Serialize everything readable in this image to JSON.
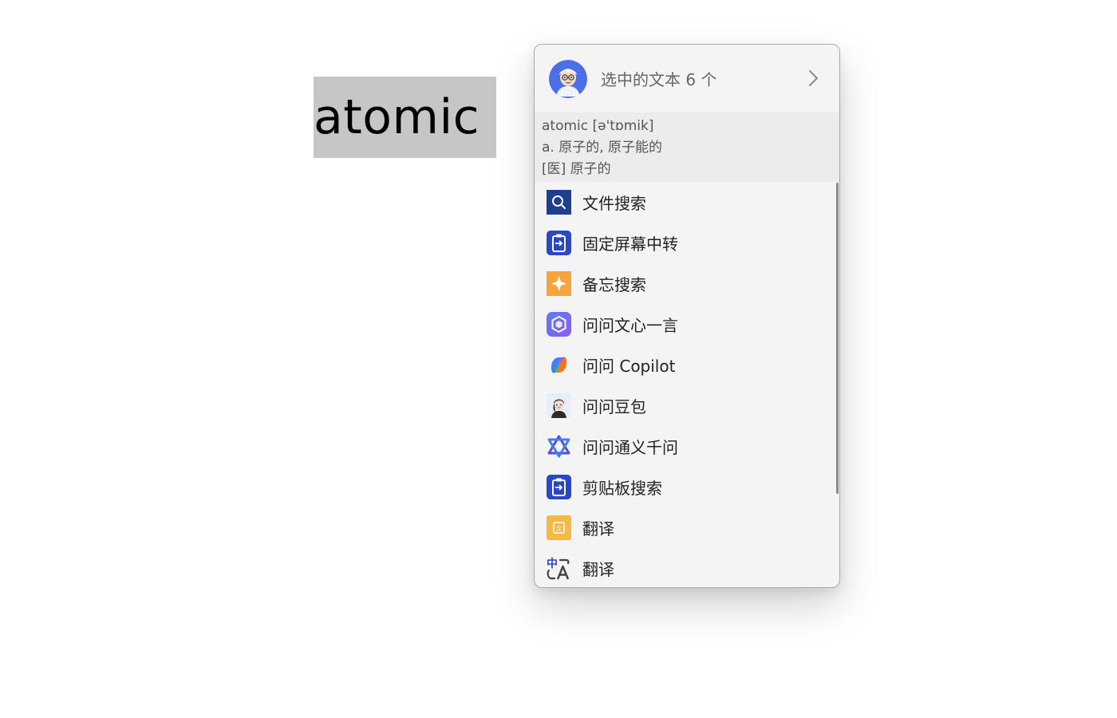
{
  "document": {
    "selected_word": "atomic"
  },
  "popup": {
    "header": {
      "title": "选中的文本 6 个",
      "avatar_icon": "cartoon-avatar-icon",
      "expand_icon": "chevron-right-icon"
    },
    "dictionary": {
      "line1": "atomic [ə'tɒmik]",
      "line2": "a. 原子的, 原子能的",
      "line3": "[医] 原子的"
    },
    "actions": [
      {
        "label": "文件搜索",
        "icon": "file-search-icon"
      },
      {
        "label": "固定屏幕中转",
        "icon": "pin-transfer-icon"
      },
      {
        "label": "备忘搜索",
        "icon": "memo-search-icon"
      },
      {
        "label": "问问文心一言",
        "icon": "ernie-bot-icon"
      },
      {
        "label": "问问 Copilot",
        "icon": "copilot-icon"
      },
      {
        "label": "问问豆包",
        "icon": "doubao-icon"
      },
      {
        "label": "问问通义千问",
        "icon": "tongyi-qianwen-icon"
      },
      {
        "label": "剪贴板搜索",
        "icon": "clipboard-search-icon"
      },
      {
        "label": "翻译",
        "icon": "translate-doc-icon"
      },
      {
        "label": "翻译",
        "icon": "translate-zh-a-icon"
      }
    ]
  },
  "colors": {
    "selection_bg": "#c6c6c6",
    "popup_bg": "#f4f4f4",
    "dict_bg": "#ececec",
    "accent_blue": "#2948c8",
    "accent_orange": "#f5a53a"
  }
}
